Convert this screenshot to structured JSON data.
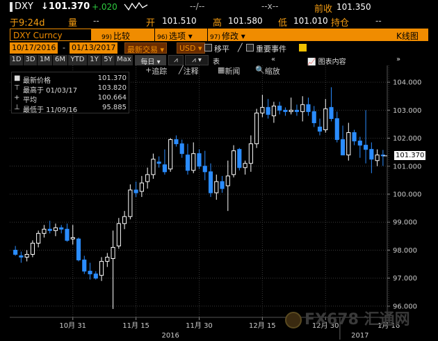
{
  "quote": {
    "ticker": "DXY",
    "last": "101.370",
    "change": "+.020",
    "dashes_a": "--/--",
    "dashes_b": "--x--",
    "prev_close_label": "前收",
    "prev_close": "101.350",
    "time": "于9:24d",
    "volume_label": "量",
    "volume": "--",
    "open_label": "开",
    "open": "101.510",
    "high_label": "高",
    "high": "101.580",
    "low_label": "低",
    "low": "101.010",
    "position_label": "持仓",
    "position": "--"
  },
  "toolbar": {
    "security": "DXY Curncy",
    "compare_num": "99)",
    "compare": "比较",
    "options_num": "96)",
    "options": "选项",
    "edit_num": "97)",
    "edit": "修改",
    "title": "K线图"
  },
  "dates": {
    "start": "10/17/2016",
    "end": "01/13/2017",
    "last_trade": "最新交易",
    "currency": "USD",
    "smooth": "移平",
    "events": "重要事件"
  },
  "periods": [
    "1D",
    "3D",
    "1M",
    "6M",
    "YTD",
    "1Y",
    "5Y",
    "Max"
  ],
  "frequency": "每日",
  "table_label": "表",
  "chart_controls": {
    "track": "追踪",
    "annotate": "注释",
    "news": "新闻",
    "zoom": "缩放",
    "icon_content": "图表内容"
  },
  "legend": {
    "items": [
      {
        "symbol": "■",
        "label": "最新价格",
        "value": "101.370"
      },
      {
        "symbol": "⊤",
        "label": "最高于 01/03/17",
        "value": "103.820"
      },
      {
        "symbol": "+",
        "label": "平均",
        "value": "100.664"
      },
      {
        "symbol": "⊥",
        "label": "最低于 11/09/16",
        "value": "95.885"
      }
    ]
  },
  "price_tag": "101.370",
  "watermark": "FX678 汇通网",
  "colors": {
    "up": "#ffffff",
    "down": "#2a8cff",
    "grid": "#3a3a3a",
    "accent": "#f08c00",
    "bg": "#000000"
  },
  "chart_data": {
    "type": "candlestick",
    "y_ticks": [
      "104.000",
      "103.000",
      "102.000",
      "101.000",
      "100.000",
      "99.000",
      "98.000",
      "97.000",
      "96.000"
    ],
    "ylim": [
      95.6,
      104.6
    ],
    "x_ticks": [
      {
        "label": "10月 31",
        "index": 10
      },
      {
        "label": "11月 15",
        "index": 21
      },
      {
        "label": "11月 30",
        "index": 32
      },
      {
        "label": "12月 15",
        "index": 43
      },
      {
        "label": "12月 30",
        "index": 54
      },
      {
        "label": "1月 16",
        "index": 65
      }
    ],
    "year_ticks": [
      {
        "label": "2016",
        "index": 27
      },
      {
        "label": "2017",
        "index": 60
      }
    ],
    "candles": [
      [
        98.0,
        98.15,
        97.8,
        97.85
      ],
      [
        97.8,
        97.95,
        97.55,
        97.75
      ],
      [
        97.75,
        98.0,
        97.6,
        97.85
      ],
      [
        97.85,
        98.35,
        97.75,
        98.25
      ],
      [
        98.25,
        98.7,
        98.1,
        98.6
      ],
      [
        98.6,
        98.9,
        98.45,
        98.75
      ],
      [
        98.75,
        99.05,
        98.6,
        98.7
      ],
      [
        98.7,
        98.95,
        98.5,
        98.8
      ],
      [
        98.8,
        98.9,
        98.6,
        98.75
      ],
      [
        98.75,
        98.95,
        98.3,
        98.35
      ],
      [
        98.4,
        98.9,
        98.2,
        98.45
      ],
      [
        98.4,
        98.45,
        97.6,
        97.65
      ],
      [
        97.65,
        97.8,
        97.15,
        97.25
      ],
      [
        97.25,
        97.55,
        96.95,
        97.15
      ],
      [
        97.15,
        97.25,
        96.95,
        97.0
      ],
      [
        97.1,
        97.75,
        96.9,
        97.6
      ],
      [
        97.6,
        97.9,
        97.4,
        97.75
      ],
      [
        97.7,
        98.7,
        95.9,
        98.1
      ],
      [
        98.15,
        99.15,
        98.05,
        98.95
      ],
      [
        98.95,
        99.4,
        98.75,
        99.2
      ],
      [
        99.2,
        100.35,
        99.1,
        100.15
      ],
      [
        100.15,
        100.45,
        99.9,
        100.05
      ],
      [
        100.1,
        100.65,
        99.9,
        100.4
      ],
      [
        100.45,
        100.95,
        100.2,
        100.7
      ],
      [
        100.7,
        101.45,
        100.55,
        101.25
      ],
      [
        101.15,
        101.35,
        100.95,
        101.1
      ],
      [
        101.05,
        101.6,
        100.7,
        100.8
      ],
      [
        100.9,
        102.0,
        100.8,
        101.95
      ],
      [
        101.95,
        102.1,
        101.7,
        101.8
      ],
      [
        101.8,
        101.95,
        101.3,
        101.45
      ],
      [
        101.4,
        101.8,
        100.7,
        100.85
      ],
      [
        100.85,
        101.85,
        100.75,
        101.45
      ],
      [
        101.45,
        101.6,
        100.9,
        101.0
      ],
      [
        101.0,
        101.55,
        100.5,
        100.8
      ],
      [
        100.8,
        101.1,
        99.9,
        100.05
      ],
      [
        100.05,
        100.7,
        99.8,
        100.45
      ],
      [
        100.45,
        100.65,
        100.05,
        100.2
      ],
      [
        100.3,
        101.2,
        99.4,
        100.65
      ],
      [
        100.7,
        101.75,
        100.6,
        101.55
      ],
      [
        101.6,
        101.65,
        100.85,
        100.95
      ],
      [
        100.95,
        101.2,
        100.7,
        101.1
      ],
      [
        101.1,
        102.1,
        100.8,
        101.8
      ],
      [
        101.8,
        103.05,
        101.65,
        102.9
      ],
      [
        102.9,
        103.55,
        102.75,
        103.1
      ],
      [
        103.1,
        103.4,
        102.7,
        102.85
      ],
      [
        102.8,
        103.3,
        102.55,
        103.15
      ],
      [
        103.15,
        103.3,
        102.85,
        103.0
      ],
      [
        103.0,
        103.1,
        102.8,
        102.95
      ],
      [
        102.95,
        103.45,
        102.85,
        103.0
      ],
      [
        103.0,
        103.2,
        102.8,
        102.95
      ],
      [
        102.95,
        103.5,
        102.6,
        103.2
      ],
      [
        103.2,
        103.45,
        102.8,
        102.95
      ],
      [
        102.95,
        103.15,
        102.4,
        102.55
      ],
      [
        102.4,
        102.7,
        102.1,
        102.25
      ],
      [
        102.3,
        103.4,
        102.2,
        103.05
      ],
      [
        103.1,
        103.82,
        102.6,
        102.7
      ],
      [
        102.7,
        102.95,
        101.85,
        101.95
      ],
      [
        101.95,
        102.45,
        101.4,
        101.4
      ],
      [
        101.4,
        102.55,
        101.2,
        102.2
      ],
      [
        102.2,
        102.3,
        101.75,
        101.9
      ],
      [
        101.9,
        102.05,
        101.3,
        101.75
      ],
      [
        101.75,
        103.0,
        101.1,
        101.6
      ],
      [
        101.6,
        101.85,
        100.75,
        101.25
      ],
      [
        101.2,
        101.6,
        101.0,
        101.4
      ],
      [
        101.4,
        101.58,
        101.01,
        101.37
      ]
    ]
  }
}
